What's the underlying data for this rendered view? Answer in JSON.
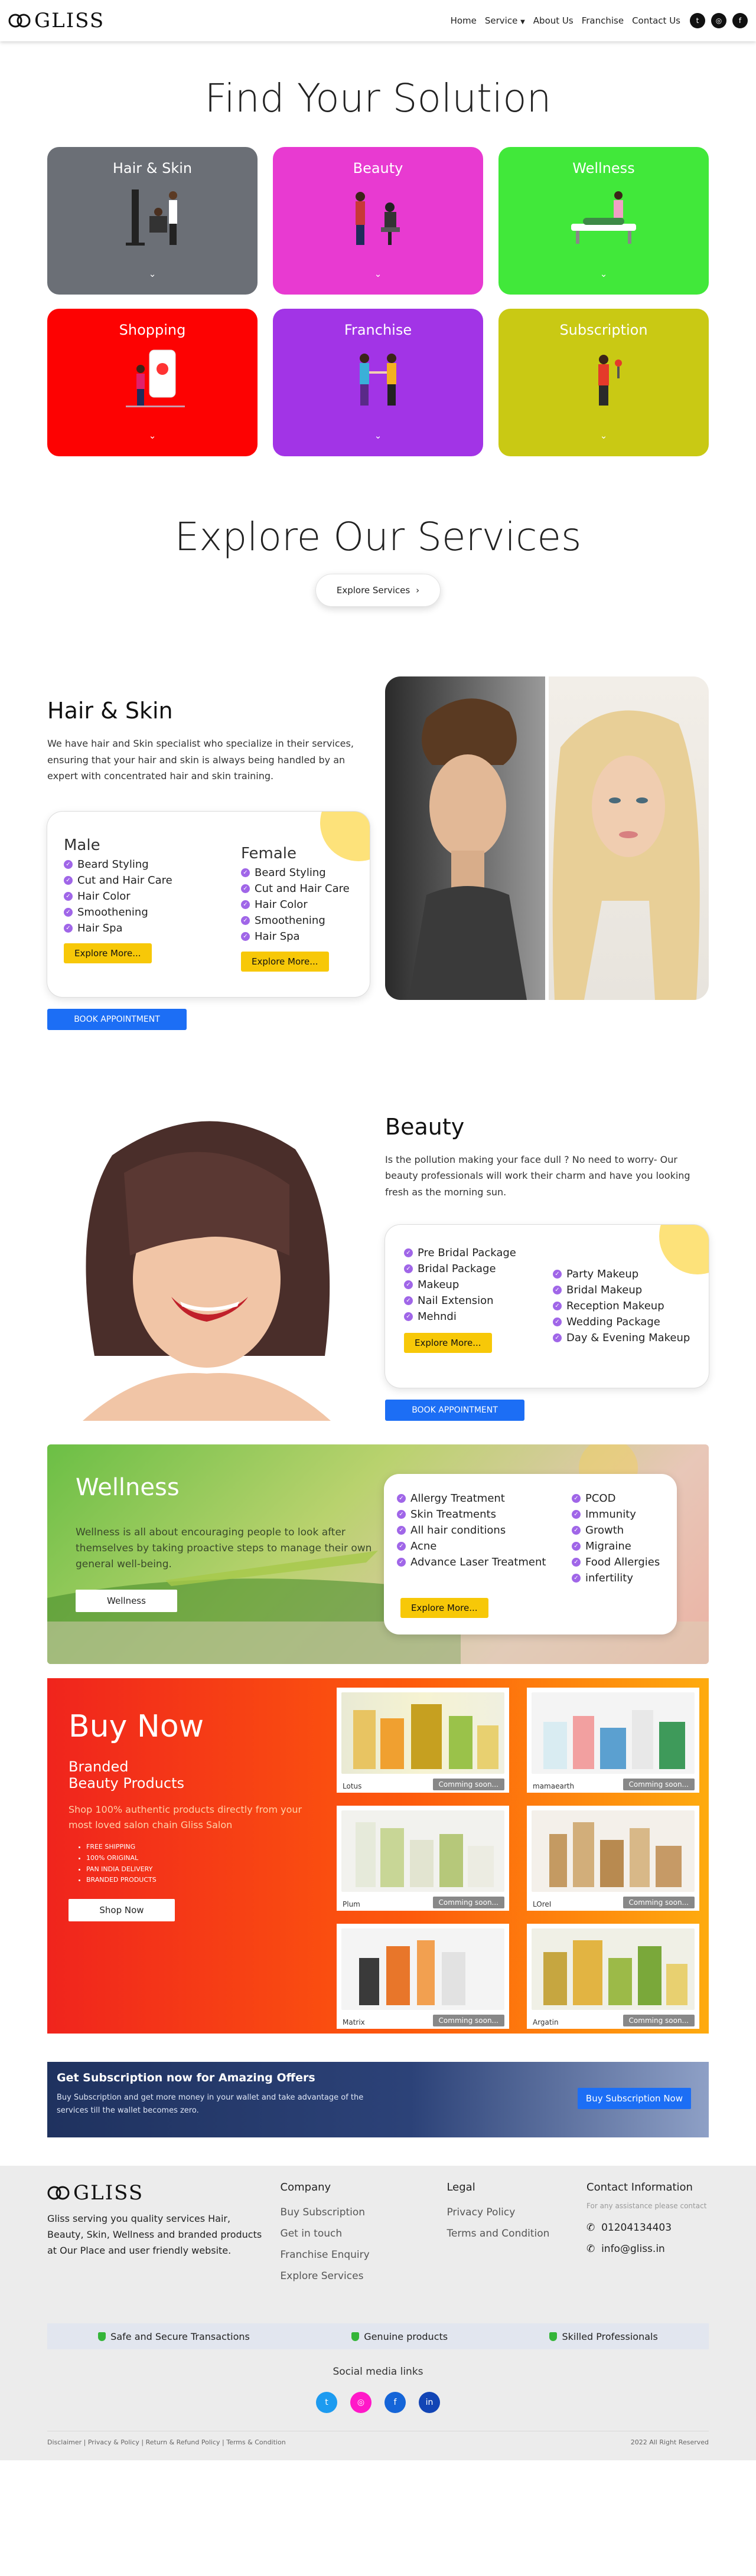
{
  "brand": {
    "name": "GLISS"
  },
  "nav": {
    "items": [
      "Home",
      "Service",
      "About Us",
      "Franchise",
      "Contact Us"
    ],
    "dropdown_icon": "caret-down-icon",
    "social": [
      "twitter-icon",
      "instagram-icon",
      "facebook-icon"
    ]
  },
  "solutions": {
    "title": "Find Your Solution",
    "cards": [
      {
        "label": "Hair & Skin",
        "color": "#6b6f76"
      },
      {
        "label": "Beauty",
        "color": "#e83ad1"
      },
      {
        "label": "Wellness",
        "color": "#41e83a"
      },
      {
        "label": "Shopping",
        "color": "#fd0202"
      },
      {
        "label": "Franchise",
        "color": "#a234e6"
      },
      {
        "label": "Subscription",
        "color": "#c9c914"
      }
    ]
  },
  "explore": {
    "title": "Explore Our Services",
    "button": "Explore Services"
  },
  "hair_skin": {
    "title": "Hair & Skin",
    "desc": "We have hair and Skin specialist who specialize in their services, ensuring that your hair and skin is always being handled by an expert with concentrated hair and skin training.",
    "male": {
      "title": "Male",
      "items": [
        "Beard Styling",
        "Cut and Hair Care",
        "Hair Color",
        "Smoothening",
        "Hair Spa"
      ],
      "button": "Explore More..."
    },
    "female": {
      "title": "Female",
      "items": [
        "Beard Styling",
        "Cut and Hair Care",
        "Hair Color",
        "Smoothening",
        "Hair Spa"
      ],
      "button": "Explore More..."
    },
    "book": "BOOK APPOINTMENT"
  },
  "beauty": {
    "title": "Beauty",
    "desc": "Is the pollution making your face dull ? No need to worry- Our beauty professionals will work their charm and have you looking fresh as the morning sun.",
    "left_items": [
      "Pre Bridal Package",
      "Bridal Package",
      "Makeup",
      "Nail Extension",
      "Mehndi"
    ],
    "right_items": [
      "Party Makeup",
      "Bridal Makeup",
      "Reception Makeup",
      "Wedding Package",
      "Day & Evening Makeup"
    ],
    "button": "Explore More...",
    "book": "BOOK APPOINTMENT"
  },
  "wellness": {
    "title": "Wellness",
    "desc": "Wellness is all about encouraging people to look after themselves by taking proactive steps to manage their own general well-being.",
    "button": "Wellness",
    "left_items": [
      "Allergy Treatment",
      "Skin Treatments",
      "All hair conditions",
      "Acne",
      "Advance Laser Treatment"
    ],
    "right_items": [
      "PCOD",
      "Immunity",
      "Growth",
      "Migraine",
      "Food Allergies",
      "infertility"
    ],
    "more": "Explore More..."
  },
  "shop": {
    "title": "Buy Now",
    "subtitle_1": "Branded",
    "subtitle_2": "Beauty Products",
    "desc": "Shop 100% authentic products directly from your most loved salon chain Gliss Salon",
    "bullets": [
      "FREE SHIPPING",
      "100% ORIGINAL",
      "PAN INDIA DELIVERY",
      "BRANDED PRODUCTS"
    ],
    "button": "Shop Now",
    "products": [
      {
        "name": "Lotus",
        "status": "Comming soon..."
      },
      {
        "name": "mamaearth",
        "status": "Comming soon..."
      },
      {
        "name": "Plum",
        "status": "Comming soon..."
      },
      {
        "name": "LOreI",
        "status": "Comming soon..."
      },
      {
        "name": "Matrix",
        "status": "Comming soon..."
      },
      {
        "name": "Argatin",
        "status": "Comming soon..."
      }
    ]
  },
  "subscription": {
    "title": "Get Subscription now for Amazing Offers",
    "desc": "Buy Subscription and get more money in your wallet and take advantage of the services till the wallet becomes zero.",
    "button": "Buy Subscription Now"
  },
  "footer": {
    "about": "Gliss serving you quality services Hair, Beauty, Skin, Wellness and branded products at Our Place and user friendly website.",
    "company_title": "Company",
    "company_links": [
      "Buy Subscription",
      "Get in touch",
      "Franchise Enquiry",
      "Explore Services"
    ],
    "legal_title": "Legal",
    "legal_links": [
      "Privacy Policy",
      "Terms and Condition"
    ],
    "contact_title": "Contact Information",
    "contact_note": "For any assistance please contact",
    "phone": "01204134403",
    "email": "info@gliss.in",
    "trust": [
      "Safe and Secure Transactions",
      "Genuine products",
      "Skilled Professionals"
    ],
    "social_title": "Social media links",
    "social_colors": [
      "#1d9bf0",
      "#ff18c8",
      "#1565d8",
      "#1245b5"
    ],
    "bottom_links": "Disclaimer | Privacy & Policy | Return & Refund Policy | Terms & Condition",
    "copyright": "2022 All Right Reserved"
  }
}
